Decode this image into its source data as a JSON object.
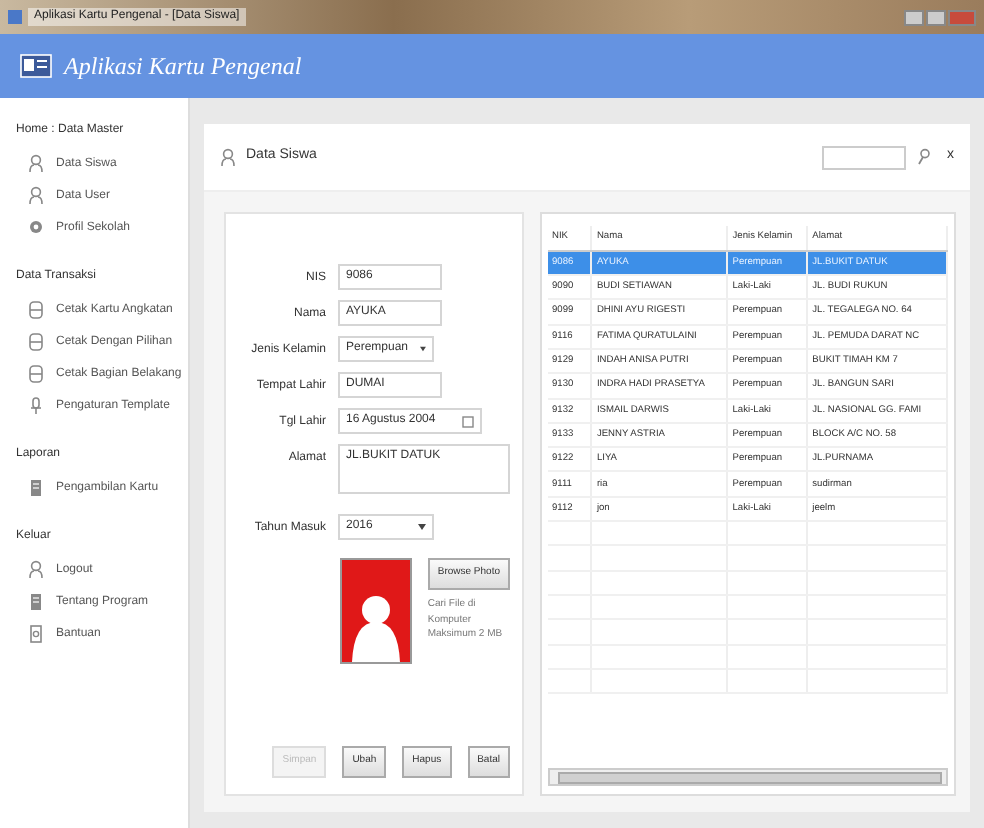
{
  "window": {
    "title": "Aplikasi Kartu Pengenal - [Data Siswa]"
  },
  "header": {
    "title": "Aplikasi Kartu Pengenal"
  },
  "sidebar": {
    "sections": [
      {
        "heading": "Home : Data Master",
        "items": [
          {
            "label": "Data Siswa",
            "kind": "user"
          },
          {
            "label": "Data User",
            "kind": "user"
          },
          {
            "label": "Profil Sekolah",
            "kind": "gear"
          }
        ]
      },
      {
        "heading": "Data Transaksi",
        "items": [
          {
            "label": "Cetak Kartu Angkatan",
            "kind": "printer"
          },
          {
            "label": "Cetak Dengan Pilihan",
            "kind": "printer"
          },
          {
            "label": "Cetak Bagian Belakang",
            "kind": "printer"
          },
          {
            "label": "Pengaturan Template",
            "kind": "pin"
          }
        ]
      },
      {
        "heading": "Laporan",
        "items": [
          {
            "label": "Pengambilan Kartu",
            "kind": "doc"
          }
        ]
      },
      {
        "heading": "Keluar",
        "items": [
          {
            "label": "Logout",
            "kind": "user"
          },
          {
            "label": "Tentang Program",
            "kind": "doc"
          },
          {
            "label": "Bantuan",
            "kind": "help"
          }
        ]
      }
    ]
  },
  "panel": {
    "title": "Data Siswa",
    "close": "x"
  },
  "form": {
    "fields": [
      {
        "label": "NIS",
        "kind": "text",
        "value": "9086"
      },
      {
        "label": "Nama",
        "kind": "text",
        "value": "AYUKA"
      },
      {
        "label": "Jenis Kelamin",
        "kind": "select",
        "value": "Perempuan"
      },
      {
        "label": "Tempat Lahir",
        "kind": "text",
        "value": "DUMAI"
      },
      {
        "label": "Tgl Lahir",
        "kind": "date",
        "value": "16 Agustus 2004"
      },
      {
        "label": "Alamat",
        "kind": "textarea",
        "value": "JL.BUKIT DATUK"
      },
      {
        "label": "Tahun Masuk",
        "kind": "select",
        "value": "2016"
      }
    ],
    "photo": {
      "button": "Browse Photo",
      "hint": "Cari File di Komputer Maksimum 2 MB"
    },
    "buttons": [
      {
        "label": "Simpan",
        "disabled": true
      },
      {
        "label": "Ubah",
        "disabled": false
      },
      {
        "label": "Hapus",
        "disabled": false
      },
      {
        "label": "Batal",
        "disabled": false
      }
    ]
  },
  "table": {
    "columns": [
      "NIK",
      "Nama",
      "Jenis Kelamin",
      "Alamat"
    ],
    "rows": [
      {
        "cells": [
          "9086",
          "AYUKA",
          "Perempuan",
          "JL.BUKIT DATUK"
        ],
        "selected": true
      },
      {
        "cells": [
          "9090",
          "BUDI SETIAWAN",
          "Laki-Laki",
          "JL. BUDI RUKUN"
        ],
        "selected": false
      },
      {
        "cells": [
          "9099",
          "DHINI AYU RIGESTI",
          "Perempuan",
          "JL. TEGALEGA NO. 64"
        ],
        "selected": false
      },
      {
        "cells": [
          "9116",
          "FATIMA QURATULAINI",
          "Perempuan",
          "JL. PEMUDA DARAT NC"
        ],
        "selected": false
      },
      {
        "cells": [
          "9129",
          "INDAH ANISA PUTRI",
          "Perempuan",
          "BUKIT TIMAH KM 7"
        ],
        "selected": false
      },
      {
        "cells": [
          "9130",
          "INDRA HADI PRASETYA",
          "Perempuan",
          "JL. BANGUN SARI"
        ],
        "selected": false
      },
      {
        "cells": [
          "9132",
          "ISMAIL DARWIS",
          "Laki-Laki",
          "JL. NASIONAL GG. FAMI"
        ],
        "selected": false
      },
      {
        "cells": [
          "9133",
          "JENNY ASTRIA",
          "Perempuan",
          "BLOCK A/C NO. 58"
        ],
        "selected": false
      },
      {
        "cells": [
          "9122",
          "LIYA",
          "Perempuan",
          "JL.PURNAMA"
        ],
        "selected": false
      },
      {
        "cells": [
          "9111",
          "ria",
          "Perempuan",
          "sudirman"
        ],
        "selected": false
      },
      {
        "cells": [
          "9112",
          "jon",
          "Laki-Laki",
          "jeelm"
        ],
        "selected": false
      }
    ]
  }
}
